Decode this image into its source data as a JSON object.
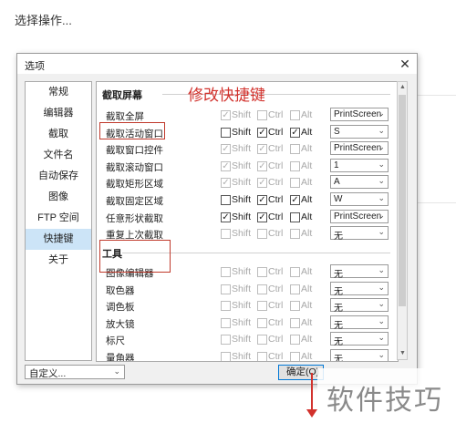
{
  "page": {
    "caption": "选择操作..."
  },
  "dialog": {
    "title": "选项",
    "close_glyph": "✕",
    "nav": [
      "常规",
      "编辑器",
      "截取",
      "文件名",
      "自动保存",
      "图像",
      "FTP 空间",
      "快捷键",
      "关于"
    ],
    "nav_selected_index": 7,
    "annotation": "修改快捷键",
    "section_capture": "截取屏幕",
    "section_tools": "工具",
    "mod_labels": {
      "shift": "Shift",
      "ctrl": "Ctrl",
      "alt": "Alt"
    },
    "check_glyph": "✓",
    "capture_rows": [
      {
        "label": "截取全屏",
        "enabled": false,
        "shift": true,
        "ctrl": false,
        "alt": false,
        "key": "PrintScreen"
      },
      {
        "label": "截取活动窗口",
        "enabled": true,
        "shift": false,
        "ctrl": true,
        "alt": true,
        "key": "S"
      },
      {
        "label": "截取窗口控件",
        "enabled": false,
        "shift": true,
        "ctrl": true,
        "alt": false,
        "key": "PrintScreen"
      },
      {
        "label": "截取滚动窗口",
        "enabled": false,
        "shift": true,
        "ctrl": true,
        "alt": false,
        "key": "1"
      },
      {
        "label": "截取矩形区域",
        "enabled": false,
        "shift": true,
        "ctrl": true,
        "alt": false,
        "key": "A"
      },
      {
        "label": "截取固定区域",
        "enabled": true,
        "shift": false,
        "ctrl": true,
        "alt": true,
        "key": "W"
      },
      {
        "label": "任意形状截取",
        "enabled": true,
        "shift": true,
        "ctrl": true,
        "alt": false,
        "key": "PrintScreen"
      },
      {
        "label": "重复上次截取",
        "enabled": false,
        "shift": false,
        "ctrl": false,
        "alt": false,
        "key": "无"
      }
    ],
    "tool_rows": [
      {
        "label": "图像编辑器",
        "enabled": false,
        "shift": false,
        "ctrl": false,
        "alt": false,
        "key": "无"
      },
      {
        "label": "取色器",
        "enabled": false,
        "shift": false,
        "ctrl": false,
        "alt": false,
        "key": "无"
      },
      {
        "label": "调色板",
        "enabled": false,
        "shift": false,
        "ctrl": false,
        "alt": false,
        "key": "无"
      },
      {
        "label": "放大镜",
        "enabled": false,
        "shift": false,
        "ctrl": false,
        "alt": false,
        "key": "无"
      },
      {
        "label": "标尺",
        "enabled": false,
        "shift": false,
        "ctrl": false,
        "alt": false,
        "key": "无"
      },
      {
        "label": "量角器",
        "enabled": false,
        "shift": false,
        "ctrl": false,
        "alt": false,
        "key": "无"
      }
    ],
    "custom_select": "自定义...",
    "ok_button": "确定(O)",
    "dropdown_glyph": "⌄"
  },
  "watermark": "软件技巧",
  "colors": {
    "annotation_red": "#d2322d",
    "nav_selected": "#cce4f7",
    "ok_border": "#0078d7"
  }
}
